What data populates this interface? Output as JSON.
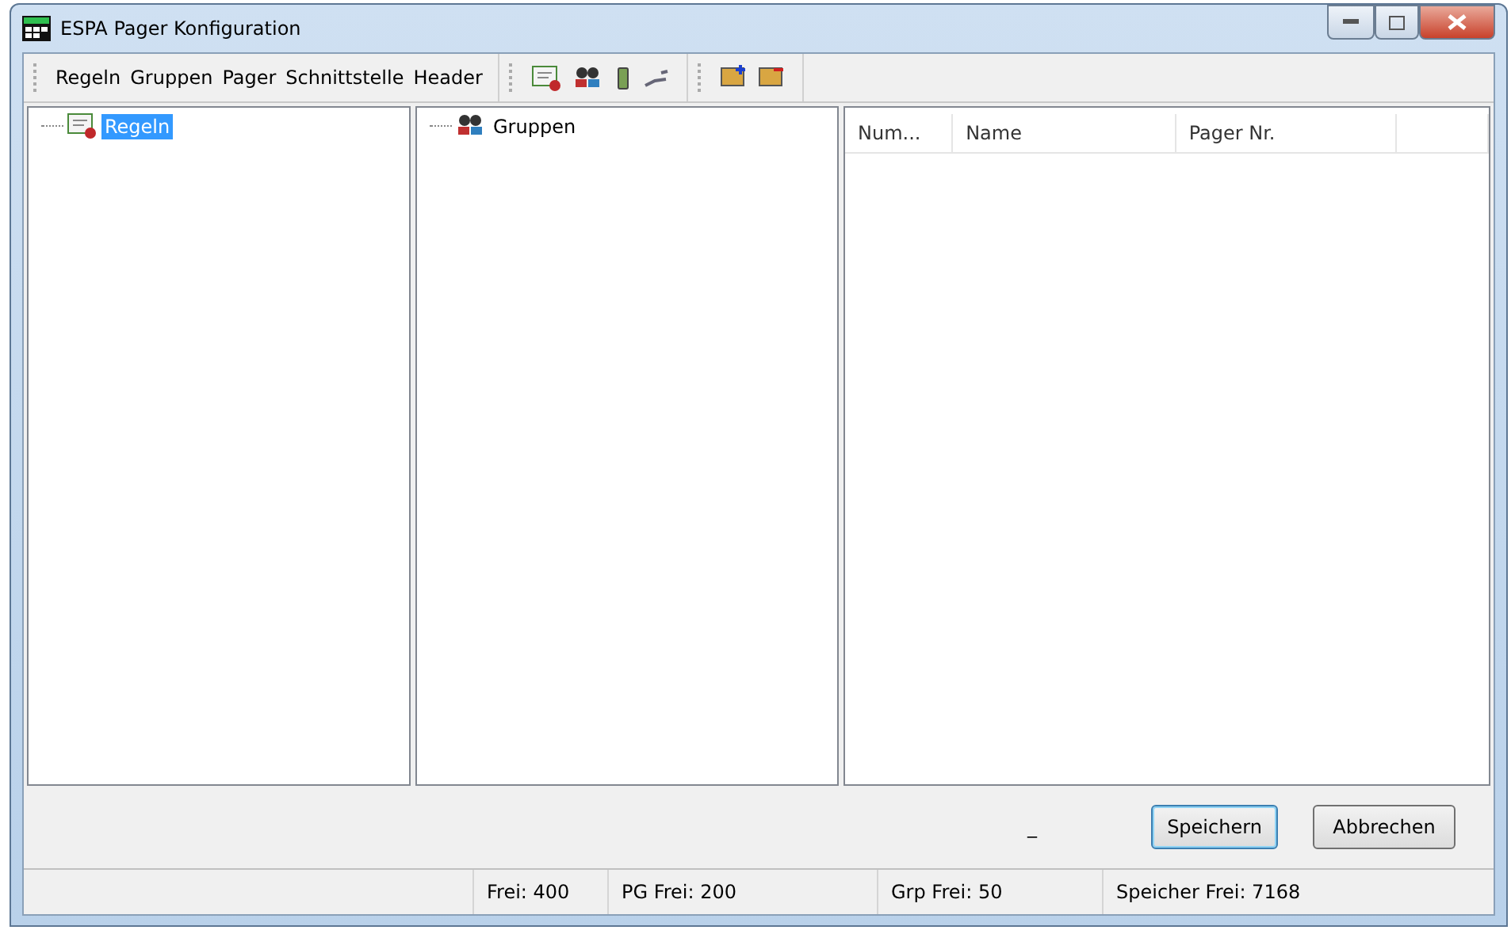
{
  "window": {
    "title": "ESPA Pager  Konfiguration"
  },
  "menu": [
    "Regeln",
    "Gruppen",
    "Pager",
    "Schnittstelle",
    "Header"
  ],
  "rules_tree": [
    {
      "label": "Regeln",
      "selected": true
    }
  ],
  "groups_tree": [
    {
      "label": "Gruppen",
      "selected": false
    }
  ],
  "list": {
    "columns": [
      "Num...",
      "Name",
      "Pager Nr."
    ]
  },
  "indicator": "_",
  "buttons": [
    {
      "label": "Speichern",
      "default": true
    },
    {
      "label": "Abbrechen",
      "default": false
    }
  ],
  "status_bar": [
    "Frei: 400",
    "PG Frei: 200",
    "Grp Frei: 50",
    "Speicher Frei: 7168"
  ]
}
